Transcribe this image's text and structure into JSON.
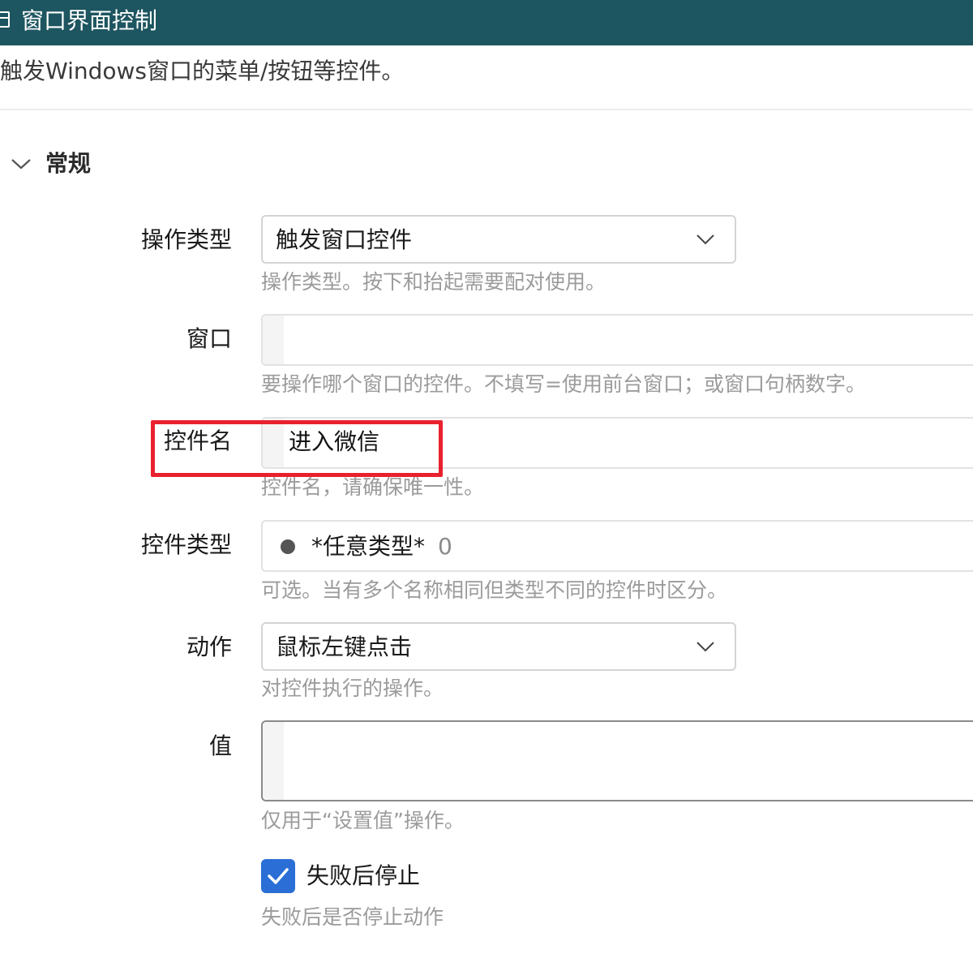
{
  "window": {
    "title": "窗口界面控制",
    "icon": "window-icon"
  },
  "description": "触发Windows窗口的菜单/按钮等控件。",
  "section": {
    "title": "常规",
    "expanded": true,
    "icon": "chevron-down-icon"
  },
  "fields": {
    "op_type": {
      "label": "操作类型",
      "value": "触发窗口控件",
      "hint": "操作类型。按下和抬起需要配对使用。"
    },
    "window": {
      "label": "窗口",
      "value": "",
      "hint": "要操作哪个窗口的控件。不填写=使用前台窗口；或窗口句柄数字。"
    },
    "control_name": {
      "label": "控件名",
      "value": "进入微信",
      "hint": "控件名，请确保唯一性。"
    },
    "control_type": {
      "label": "控件类型",
      "value": "*任意类型*",
      "count": "0",
      "hint": "可选。当有多个名称相同但类型不同的控件时区分。"
    },
    "action": {
      "label": "动作",
      "value": "鼠标左键点击",
      "hint": "对控件执行的操作。"
    },
    "value": {
      "label": "值",
      "value": "",
      "hint": "仅用于“设置值”操作。"
    },
    "stop_on_fail": {
      "label": "失败后停止",
      "checked": true,
      "hint": "失败后是否停止动作"
    }
  },
  "colors": {
    "titlebar": "#1d5560",
    "checkbox": "#2b6fd6",
    "highlight": "#e8212f"
  }
}
